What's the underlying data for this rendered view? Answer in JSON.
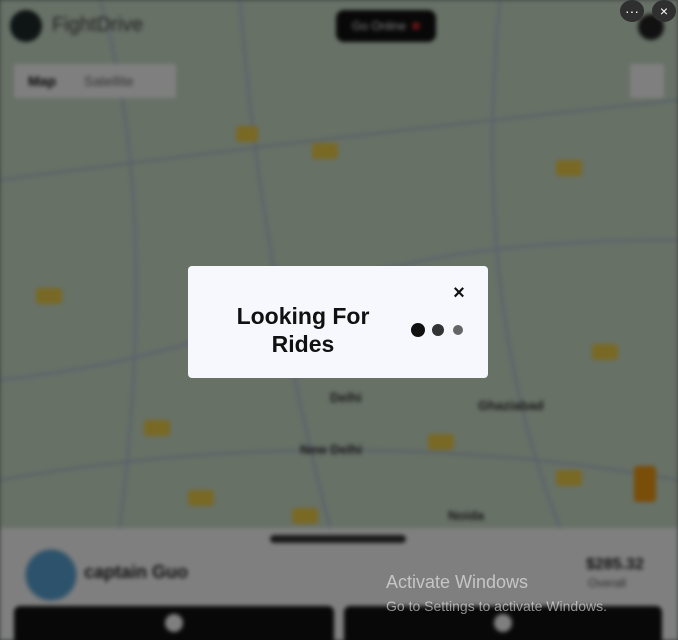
{
  "app": {
    "brand": "FightDrive"
  },
  "header": {
    "go_online_label": "Go Online"
  },
  "map": {
    "type_tabs": [
      "Map",
      "Satellite"
    ],
    "labels": [
      "Delhi",
      "New Delhi",
      "Ghaziabad",
      "Noida"
    ]
  },
  "driver_sheet": {
    "captain_name": "captain Guo",
    "fare_amount": "$285.32",
    "fare_label": "Overall"
  },
  "modal": {
    "title": "Looking For Rides",
    "close_glyph": "×"
  },
  "window_controls": {
    "more_glyph": "···",
    "close_glyph": "×"
  },
  "os_watermark": {
    "line1": "Activate Windows",
    "line2": "Go to Settings to activate Windows."
  },
  "colors": {
    "map_background": "#cfe2cd",
    "overlay": "rgba(0,0,0,0.5)",
    "modal_background": "#f7f8fd",
    "go_online_dot": "#c62828",
    "loading_dots": [
      "#111111",
      "#333333",
      "#666666"
    ]
  },
  "icons": [
    "pin-icon",
    "fullscreen-icon",
    "pegman-icon",
    "close-icon",
    "more-icon",
    "user-icon"
  ]
}
